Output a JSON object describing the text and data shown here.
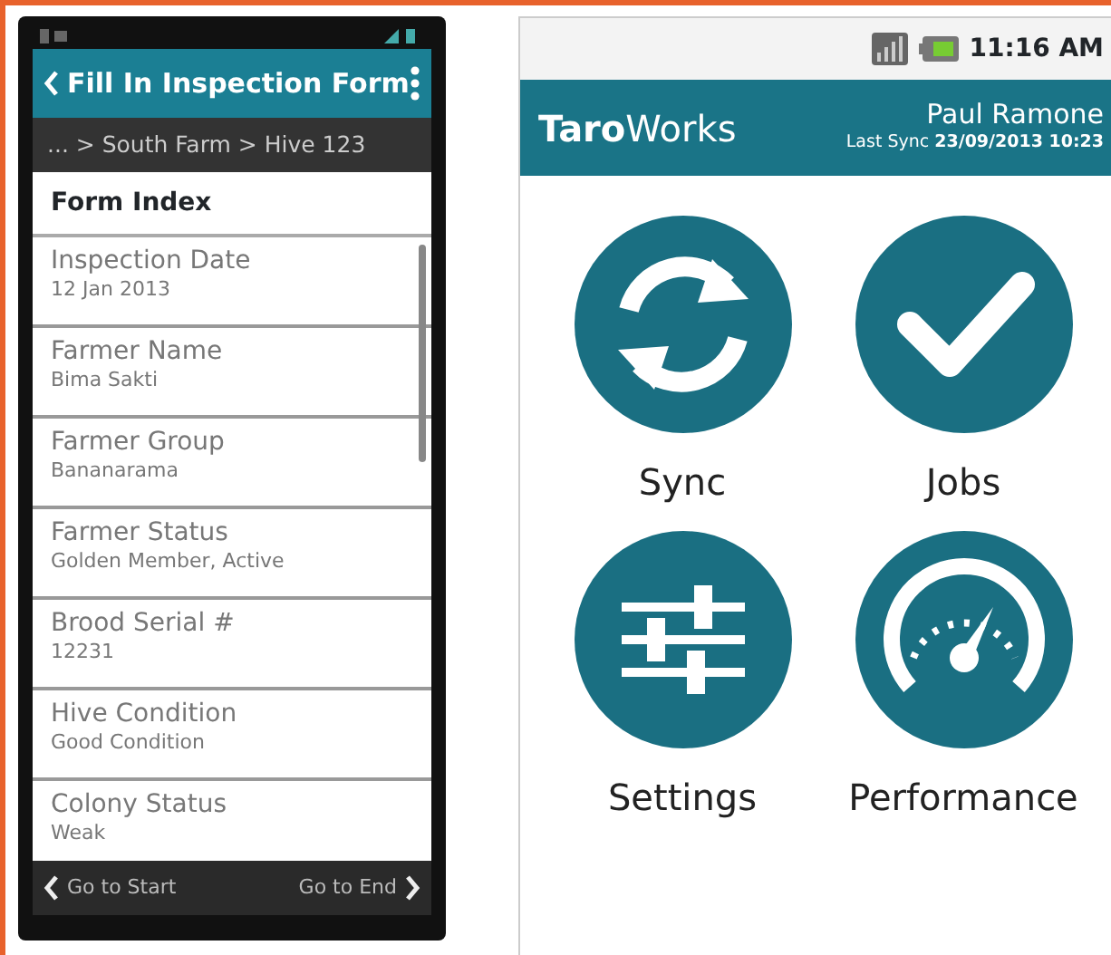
{
  "form_phone": {
    "title": "Fill In Inspection Form",
    "breadcrumb": "... > South Farm > Hive 123",
    "index_heading": "Form Index",
    "fields": [
      {
        "label": "Inspection Date",
        "value": "12 Jan 2013"
      },
      {
        "label": "Farmer Name",
        "value": "Bima Sakti"
      },
      {
        "label": "Farmer Group",
        "value": "Bananarama"
      },
      {
        "label": "Farmer Status",
        "value": "Golden Member, Active"
      },
      {
        "label": "Brood Serial #",
        "value": "12231"
      },
      {
        "label": "Hive Condition",
        "value": "Good Condition"
      },
      {
        "label": "Colony Status",
        "value": "Weak"
      }
    ],
    "nav": {
      "start": "Go to Start",
      "end": "Go to End"
    }
  },
  "home_phone": {
    "time": "11:16 AM",
    "brand": "**Taro**Works",
    "user": "Paul Ramone",
    "last_sync": "Last Sync **23/09/2013 10:23**",
    "tiles": [
      {
        "kind": "sync",
        "label": "Sync"
      },
      {
        "kind": "jobs",
        "label": "Jobs"
      },
      {
        "kind": "settings",
        "label": "Settings"
      },
      {
        "kind": "performance",
        "label": "Performance"
      }
    ]
  }
}
